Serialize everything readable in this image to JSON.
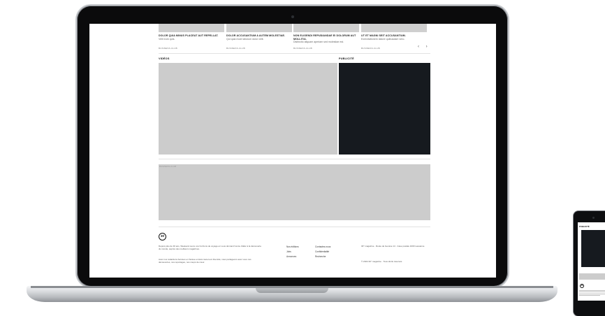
{
  "articles": [
    {
      "title": "DOLOR QUIA MINUS PLACEAT AUT REPELLAT.",
      "subtitle": "Velit eum quis.",
      "category": "BUSINESS-CLUB"
    },
    {
      "title": "DOLOR ACCUSANTIUM A AUTEM MOLESTIAE.",
      "subtitle": "Qui quia modi laborum dolor velit.",
      "category": "BUSINESS-CLUB"
    },
    {
      "title": "NON ELIGENDI REPUDIANDAE EI DOLORUM AUT MOLLITIA.",
      "subtitle": "Distinctio aliquam aperiam sed molestiae est.",
      "category": "BUSINESS-CLUB"
    },
    {
      "title": "UT ET MAGNI SEIT ACCUSANTIUM.",
      "subtitle": "Exercitationem labore quibusdam vero.",
      "category": "BUSINESS-CLUB"
    }
  ],
  "carousel": {
    "prev": "‹",
    "next": "›"
  },
  "sections": {
    "videos": "VIDÉOS",
    "pub": "PUBLICITÉ"
  },
  "banner_category": "BUSINESS-CLUB",
  "footer": {
    "logo": "30",
    "about_1": "Depuis plus de 30 ans, Weekend ouvre vos horizons de voyage en vous donnant l'envie d'aller à la découverte du monde, auprès des meilleurs magazines.",
    "about_2": "Avec nos rédactions bercées en Suisse et dans toute leur diversité, nous partageons avec vous nos découvertes, nos reportages, nos coups de cœur.",
    "links_a": [
      "Nos éditions",
      "Jobs",
      "Annonces"
    ],
    "links_b": [
      "Contactez-nous",
      "Confidentialité",
      "Recherche"
    ],
    "address": "30° magazine · Route de Genève 14 · Case postale 1000 Lausanne",
    "copyright": "© 2024 30° magazine · Tous droits réservés"
  },
  "phone": {
    "label": "PUBLICITÉ",
    "logo": "30"
  }
}
